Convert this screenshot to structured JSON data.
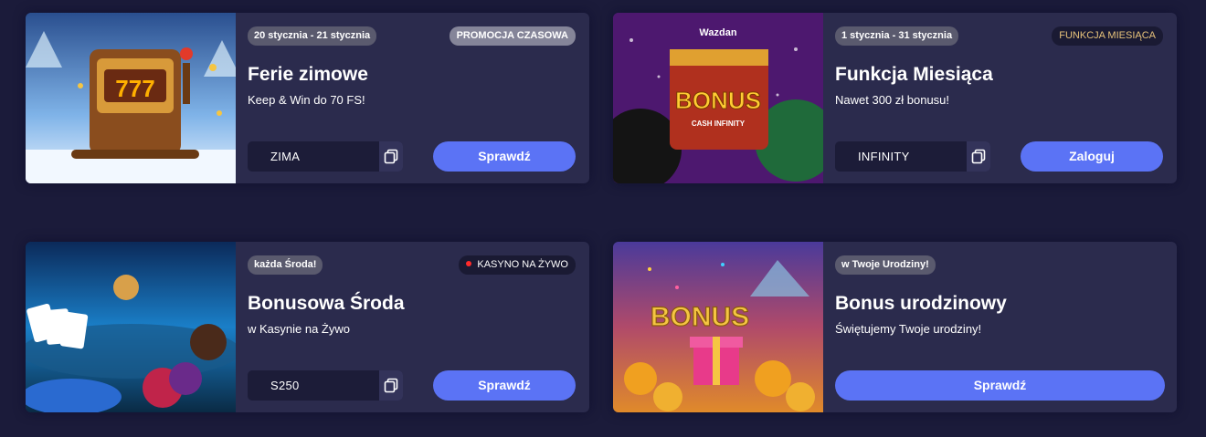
{
  "promotions": [
    {
      "date": "20 stycznia - 21 stycznia",
      "tag": "PROMOCJA CZASOWA",
      "title": "Ferie zimowe",
      "subtitle": "Keep & Win do 70 FS!",
      "code": "ZIMA",
      "button": "Sprawdź",
      "image_icon": "winter-slot-machine-image"
    },
    {
      "date": "1 stycznia - 31 stycznia",
      "tag": "FUNKCJA MIESIĄCA",
      "title": "Funkcja Miesiąca",
      "subtitle": "Nawet 300 zł bonusu!",
      "code": "INFINITY",
      "button": "Zaloguj",
      "image_text_logo": "Wazdan",
      "image_text_main": "BONUS",
      "image_text_sub": "CASH INFINITY",
      "image_icon": "wazdan-bonus-image"
    },
    {
      "date": "każda Środa!",
      "tag": "KASYNO NA ŻYWO",
      "title": "Bonusowa Środa",
      "subtitle": "w Kasynie na Żywo",
      "code": "S250",
      "button": "Sprawdź",
      "image_icon": "live-casino-image"
    },
    {
      "date": "w Twoje Urodziny!",
      "title": "Bonus urodzinowy",
      "subtitle": "Świętujemy Twoje urodziny!",
      "button": "Sprawdź",
      "image_text_main": "BONUS",
      "image_icon": "birthday-gift-image"
    }
  ],
  "colors": {
    "background": "#1b1b3a",
    "card": "#2b2b4d",
    "accent_button": "#5b73f5",
    "code_field": "#1c1c38",
    "live_dot": "#ff2a2a",
    "feature_tag_text": "#e7c27a"
  },
  "icons": {
    "copy": "copy-icon",
    "live": "live-dot-icon"
  }
}
